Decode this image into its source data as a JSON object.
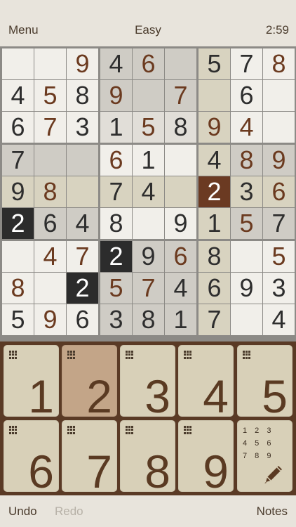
{
  "header": {
    "menu_label": "Menu",
    "difficulty": "Easy",
    "timer": "2:59"
  },
  "board": {
    "rows": [
      [
        "",
        "",
        "9",
        "4",
        "6",
        "",
        "5",
        "7",
        "8"
      ],
      [
        "4",
        "5",
        "8",
        "9",
        "",
        "7",
        "",
        "6",
        ""
      ],
      [
        "6",
        "7",
        "3",
        "1",
        "5",
        "8",
        "9",
        "4",
        ""
      ],
      [
        "7",
        "",
        "",
        "6",
        "1",
        "",
        "4",
        "8",
        "9"
      ],
      [
        "9",
        "8",
        "",
        "7",
        "4",
        "",
        "2",
        "3",
        "6"
      ],
      [
        "2",
        "6",
        "4",
        "8",
        "",
        "9",
        "1",
        "5",
        "7"
      ],
      [
        "",
        "4",
        "7",
        "2",
        "9",
        "6",
        "8",
        "",
        "5"
      ],
      [
        "8",
        "",
        "2",
        "5",
        "7",
        "4",
        "6",
        "9",
        "3"
      ],
      [
        "5",
        "9",
        "6",
        "3",
        "8",
        "1",
        "7",
        "",
        "4"
      ]
    ],
    "bg": [
      [
        "white",
        "white",
        "white",
        "grey",
        "grey",
        "grey",
        "tan",
        "white",
        "white"
      ],
      [
        "white",
        "white",
        "white",
        "grey",
        "grey",
        "grey",
        "tan",
        "white",
        "white"
      ],
      [
        "white",
        "white",
        "white",
        "light",
        "light",
        "light",
        "tan",
        "white",
        "white"
      ],
      [
        "grey",
        "grey",
        "grey",
        "white",
        "white",
        "white",
        "tan",
        "grey",
        "grey"
      ],
      [
        "tan",
        "tan",
        "tan",
        "tan",
        "tan",
        "tan",
        "brown",
        "tan",
        "tan"
      ],
      [
        "dark",
        "grey",
        "grey",
        "white",
        "white",
        "white",
        "tan",
        "grey",
        "grey"
      ],
      [
        "white",
        "white",
        "white",
        "dark",
        "grey",
        "grey",
        "tan",
        "white",
        "white"
      ],
      [
        "white",
        "white",
        "dark",
        "grey",
        "grey",
        "grey",
        "tan",
        "white",
        "white"
      ],
      [
        "white",
        "white",
        "white",
        "grey",
        "grey",
        "grey",
        "tan",
        "white",
        "white"
      ]
    ],
    "fg": [
      [
        "dark",
        "dark",
        "brown",
        "dark",
        "brown",
        "dark",
        "dark",
        "dark",
        "brown"
      ],
      [
        "dark",
        "brown",
        "dark",
        "brown",
        "dark",
        "brown",
        "dark",
        "dark",
        "dark"
      ],
      [
        "dark",
        "brown",
        "dark",
        "dark",
        "brown",
        "dark",
        "brown",
        "brown",
        "dark"
      ],
      [
        "dark",
        "dark",
        "dark",
        "brown",
        "dark",
        "dark",
        "dark",
        "brown",
        "brown"
      ],
      [
        "dark",
        "brown",
        "dark",
        "dark",
        "dark",
        "dark",
        "white",
        "dark",
        "brown"
      ],
      [
        "white",
        "dark",
        "dark",
        "dark",
        "dark",
        "dark",
        "dark",
        "brown",
        "dark"
      ],
      [
        "dark",
        "brown",
        "brown",
        "white",
        "dark",
        "brown",
        "dark",
        "dark",
        "brown"
      ],
      [
        "brown",
        "dark",
        "white",
        "brown",
        "brown",
        "dark",
        "dark",
        "dark",
        "dark"
      ],
      [
        "dark",
        "brown",
        "dark",
        "dark",
        "dark",
        "dark",
        "dark",
        "dark",
        "dark"
      ]
    ]
  },
  "numpad": {
    "keys": [
      "1",
      "2",
      "3",
      "4",
      "5",
      "6",
      "7",
      "8",
      "9"
    ],
    "selected": "2",
    "notes_digits": [
      "1 2 3",
      "4 5 6",
      "7 8 9"
    ]
  },
  "footer": {
    "undo_label": "Undo",
    "redo_label": "Redo",
    "notes_label": "Notes"
  },
  "colors": {
    "brown_text": "#6b3a1f",
    "dark_text": "#2e2e2e",
    "frame": "#5a3a25"
  }
}
